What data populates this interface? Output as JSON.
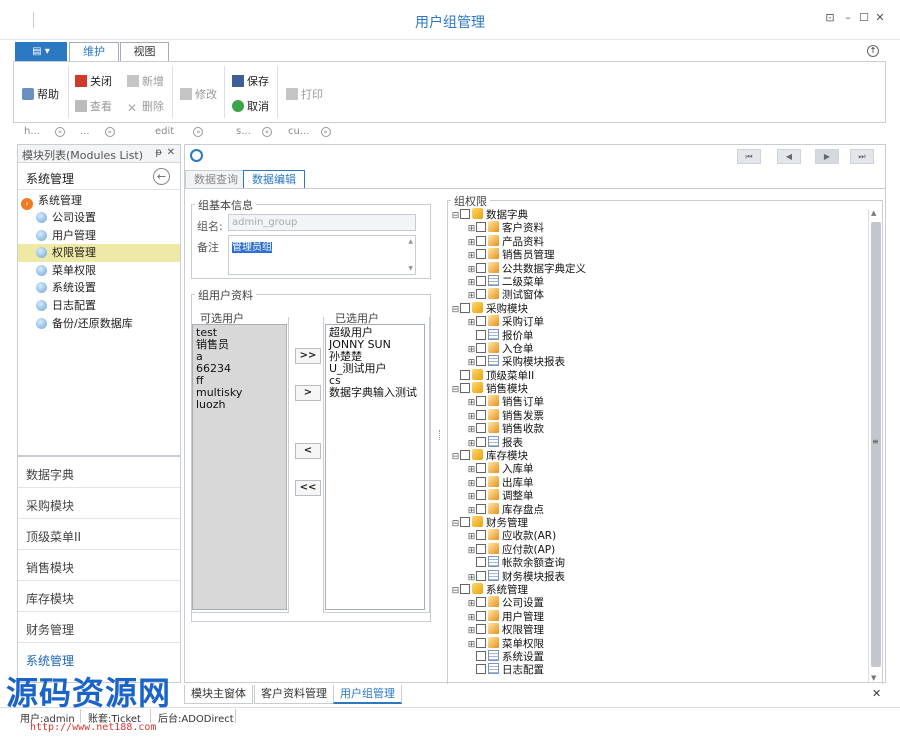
{
  "window": {
    "title": "用户组管理"
  },
  "ribbon": {
    "tabs": [
      "维护",
      "视图"
    ],
    "active_tab": "维护",
    "buttons": {
      "help": "帮助",
      "close": "关闭",
      "new": "新增",
      "edit": "修改",
      "save": "保存",
      "print": "打印",
      "view": "查看",
      "delete": "删除",
      "cancel": "取消"
    },
    "groups": [
      "h...",
      "...",
      "edit",
      "s...",
      "cu..."
    ]
  },
  "left_panel": {
    "header": "模块列表(Modules List)",
    "pin": "ᵽ",
    "section_title": "系统管理",
    "tree_root": "系统管理",
    "tree_items": [
      "公司设置",
      "用户管理",
      "权限管理",
      "菜单权限",
      "系统设置",
      "日志配置",
      "备份/还原数据库"
    ],
    "selected_item": "权限管理",
    "nav_groups": [
      "数据字典",
      "采购模块",
      "顶级菜单II",
      "销售模块",
      "库存模块",
      "财务管理",
      "系统管理"
    ]
  },
  "main": {
    "tabs": [
      "数据查询",
      "数据编辑"
    ],
    "active_tab": "数据编辑",
    "basic_info": {
      "title": "组基本信息",
      "name_label": "组名:",
      "name_value": "admin_group",
      "note_label": "备注",
      "note_value": "管理员组"
    },
    "users": {
      "title": "组用户资料",
      "available_title": "可选用户",
      "selected_title": "已选用户",
      "available": [
        "test",
        "销售员",
        "a",
        "66234",
        "ff",
        "multisky",
        "luozh"
      ],
      "selected": [
        "超级用户",
        "JONNY SUN",
        "孙楚楚",
        "U_测试用户",
        "cs",
        "数据字典输入测试"
      ],
      "buttons": [
        ">>",
        ">",
        "<",
        "<<"
      ]
    },
    "permissions": {
      "title": "组权限",
      "tree": [
        {
          "level": 0,
          "expand": "⊟",
          "icon": "folder",
          "label": "数据字典"
        },
        {
          "level": 1,
          "expand": "⊞",
          "icon": "doc",
          "label": "客户资料"
        },
        {
          "level": 1,
          "expand": "⊞",
          "icon": "doc",
          "label": "产品资料"
        },
        {
          "level": 1,
          "expand": "⊞",
          "icon": "doc",
          "label": "销售员管理"
        },
        {
          "level": 1,
          "expand": "⊞",
          "icon": "doc",
          "label": "公共数据字典定义"
        },
        {
          "level": 1,
          "expand": "⊞",
          "icon": "grid",
          "label": "二级菜单"
        },
        {
          "level": 1,
          "expand": "⊞",
          "icon": "doc",
          "label": "测试窗体"
        },
        {
          "level": 0,
          "expand": "⊟",
          "icon": "folder",
          "label": "采购模块"
        },
        {
          "level": 1,
          "expand": "⊞",
          "icon": "doc",
          "label": "采购订单"
        },
        {
          "level": 1,
          "expand": "",
          "icon": "grid",
          "label": "报价单"
        },
        {
          "level": 1,
          "expand": "⊞",
          "icon": "doc",
          "label": "入仓单"
        },
        {
          "level": 1,
          "expand": "⊞",
          "icon": "grid",
          "label": "采购模块报表"
        },
        {
          "level": 0,
          "expand": "",
          "icon": "folder",
          "label": "顶级菜单II"
        },
        {
          "level": 0,
          "expand": "⊟",
          "icon": "folder",
          "label": "销售模块"
        },
        {
          "level": 1,
          "expand": "⊞",
          "icon": "doc",
          "label": "销售订单"
        },
        {
          "level": 1,
          "expand": "⊞",
          "icon": "doc",
          "label": "销售发票"
        },
        {
          "level": 1,
          "expand": "⊞",
          "icon": "doc",
          "label": "销售收款"
        },
        {
          "level": 1,
          "expand": "⊞",
          "icon": "grid",
          "label": "报表"
        },
        {
          "level": 0,
          "expand": "⊟",
          "icon": "folder",
          "label": "库存模块"
        },
        {
          "level": 1,
          "expand": "⊞",
          "icon": "doc",
          "label": "入库单"
        },
        {
          "level": 1,
          "expand": "⊞",
          "icon": "doc",
          "label": "出库单"
        },
        {
          "level": 1,
          "expand": "⊞",
          "icon": "doc",
          "label": "调整单"
        },
        {
          "level": 1,
          "expand": "⊞",
          "icon": "doc",
          "label": "库存盘点"
        },
        {
          "level": 0,
          "expand": "⊟",
          "icon": "folder",
          "label": "财务管理"
        },
        {
          "level": 1,
          "expand": "⊞",
          "icon": "doc",
          "label": "应收款(AR)"
        },
        {
          "level": 1,
          "expand": "⊞",
          "icon": "doc",
          "label": "应付款(AP)"
        },
        {
          "level": 1,
          "expand": "",
          "icon": "grid",
          "label": "帐款余额查询"
        },
        {
          "level": 1,
          "expand": "⊞",
          "icon": "grid",
          "label": "财务模块报表"
        },
        {
          "level": 0,
          "expand": "⊟",
          "icon": "folder",
          "label": "系统管理"
        },
        {
          "level": 1,
          "expand": "⊞",
          "icon": "doc",
          "label": "公司设置"
        },
        {
          "level": 1,
          "expand": "⊞",
          "icon": "doc",
          "label": "用户管理"
        },
        {
          "level": 1,
          "expand": "⊞",
          "icon": "doc",
          "label": "权限管理"
        },
        {
          "level": 1,
          "expand": "⊞",
          "icon": "doc",
          "label": "菜单权限"
        },
        {
          "level": 1,
          "expand": "",
          "icon": "grid",
          "label": "系统设置"
        },
        {
          "level": 1,
          "expand": "",
          "icon": "grid",
          "label": "日志配置"
        }
      ]
    }
  },
  "bottom_tabs": [
    "模块主窗体",
    "客户资料管理",
    "用户组管理"
  ],
  "active_bottom_tab": "用户组管理",
  "status": {
    "user": "用户:admin",
    "account": "账套:Ticket",
    "backend": "后台:ADODirect"
  },
  "watermark": {
    "text": "源码资源网",
    "url": "http://www.net188.com"
  },
  "colors": {
    "accent": "#2b79c2",
    "selected_bg": "#efe9a6",
    "active_nav": "#1b64b8"
  }
}
